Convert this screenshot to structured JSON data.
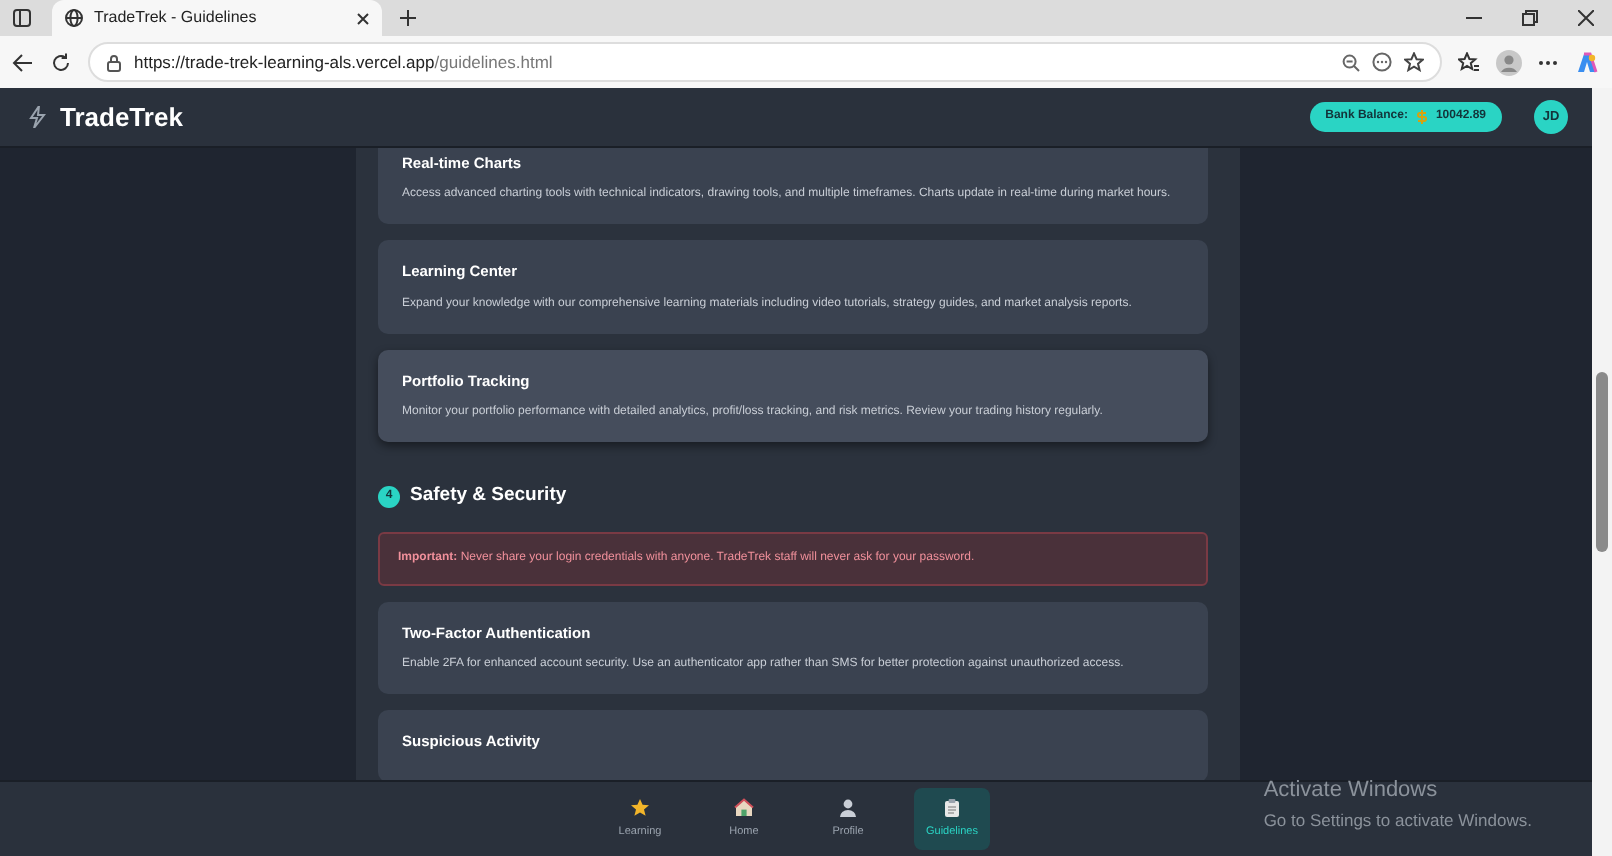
{
  "browser": {
    "tab_title": "TradeTrek - Guidelines",
    "url_host": "https://trade-trek-learning-als.vercel.app",
    "url_path": "/guidelines.html"
  },
  "header": {
    "brand": "TradeTrek",
    "balance_label": "Bank Balance:",
    "balance_amount": "10042.89",
    "avatar": "JD"
  },
  "cards_top": [
    {
      "title": "Real-time Charts",
      "text": "Access advanced charting tools with technical indicators, drawing tools, and multiple timeframes. Charts update in real-time during market hours.",
      "highlighted": false
    },
    {
      "title": "Learning Center",
      "text": "Expand your knowledge with our comprehensive learning materials including video tutorials, strategy guides, and market analysis reports.",
      "highlighted": false
    },
    {
      "title": "Portfolio Tracking",
      "text": "Monitor your portfolio performance with detailed analytics, profit/loss tracking, and risk metrics. Review your trading history regularly.",
      "highlighted": true
    }
  ],
  "section": {
    "number": "4",
    "title": "Safety & Security",
    "alert": "**Important:** Never share your login credentials with anyone. TradeTrek staff will never ask for your password.",
    "cards": [
      {
        "title": "Two-Factor Authentication",
        "text": "Enable 2FA for enhanced account security. Use an authenticator app rather than SMS for better protection against unauthorized access.",
        "highlighted": false
      },
      {
        "title": "Suspicious Activity",
        "highlighted": false
      }
    ]
  },
  "bottom_nav": [
    {
      "kind": "star",
      "label": "Learning",
      "selected": false
    },
    {
      "kind": "home",
      "label": "Home",
      "selected": false
    },
    {
      "kind": "profile",
      "label": "Profile",
      "selected": false
    },
    {
      "kind": "clipboard",
      "label": "Guidelines",
      "selected": true
    }
  ],
  "os_notice": {
    "title": "Activate Windows",
    "text": "Go to Settings to activate Windows."
  }
}
